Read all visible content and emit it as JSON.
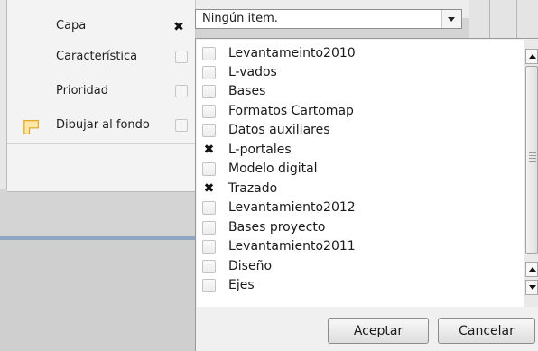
{
  "properties": {
    "rows": [
      {
        "label": "Capa",
        "checked": true
      },
      {
        "label": "Característica",
        "checked": false
      },
      {
        "label": "Prioridad",
        "checked": false
      },
      {
        "label": "Dibujar al fondo",
        "checked": false
      }
    ]
  },
  "combo": {
    "value": "Ningún item.",
    "icon": "chevron-down-icon"
  },
  "dropdown": {
    "items": [
      {
        "label": "Levantameinto2010",
        "checked": false
      },
      {
        "label": "L-vados",
        "checked": false
      },
      {
        "label": "Bases",
        "checked": false
      },
      {
        "label": "Formatos Cartomap",
        "checked": false
      },
      {
        "label": "Datos auxiliares",
        "checked": false
      },
      {
        "label": "L-portales",
        "checked": true
      },
      {
        "label": "Modelo digital",
        "checked": false
      },
      {
        "label": "Trazado",
        "checked": true
      },
      {
        "label": "Levantamiento2012",
        "checked": false
      },
      {
        "label": "Bases proyecto",
        "checked": false
      },
      {
        "label": "Levantamiento2011",
        "checked": false
      },
      {
        "label": "Diseño",
        "checked": false
      },
      {
        "label": "Ejes",
        "checked": false
      }
    ],
    "accept_label": "Aceptar",
    "cancel_label": "Cancelar"
  },
  "colors": {
    "folder_fill": "#fde7a6",
    "folder_stroke": "#e2a629",
    "selection_line": "#8fa6c2"
  }
}
